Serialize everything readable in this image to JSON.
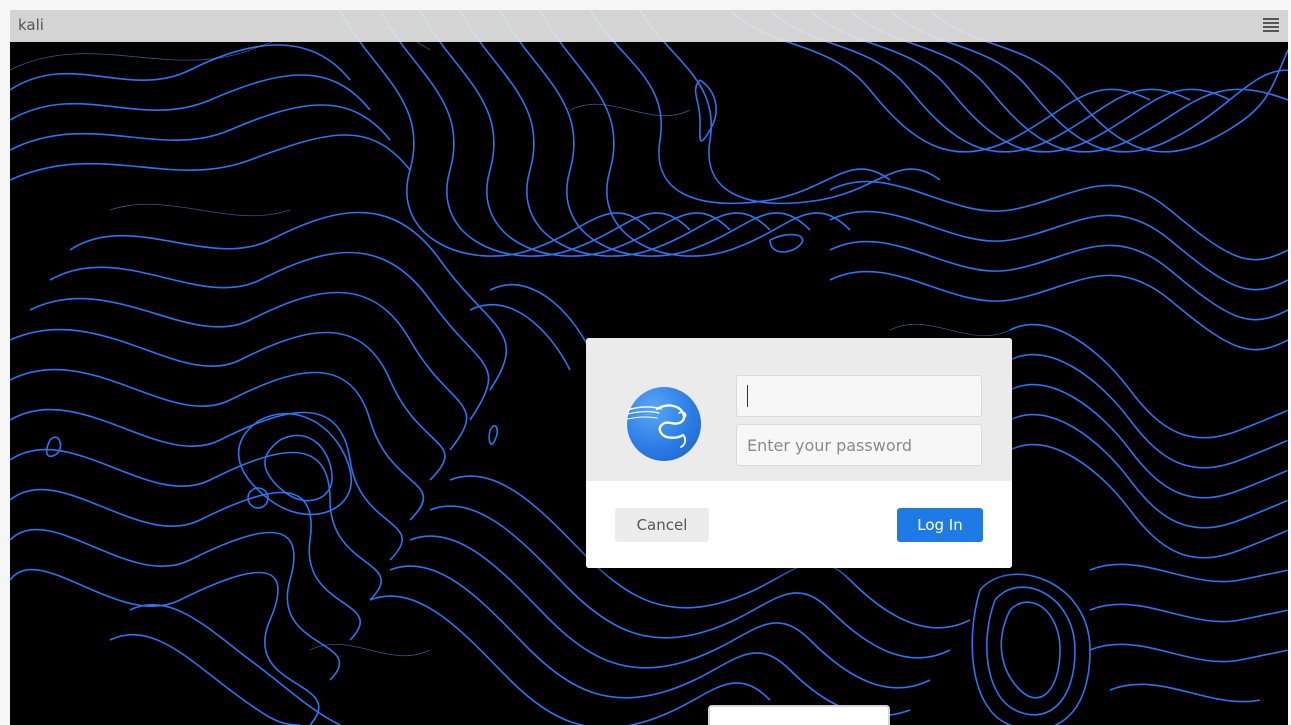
{
  "topbar": {
    "hostname": "kali",
    "menu_icon": "hamburger-menu-icon"
  },
  "wallpaper": {
    "theme": "topographic contour lines",
    "line_color": "#2f7bff",
    "background_color": "#000000"
  },
  "login_dialog": {
    "avatar_icon": "kali-dragon-logo-icon",
    "username": {
      "value": "",
      "placeholder": ""
    },
    "password": {
      "value": "",
      "placeholder": "Enter your password"
    },
    "cancel_label": "Cancel",
    "login_label": "Log In",
    "accent_color": "#1f7ae6"
  }
}
